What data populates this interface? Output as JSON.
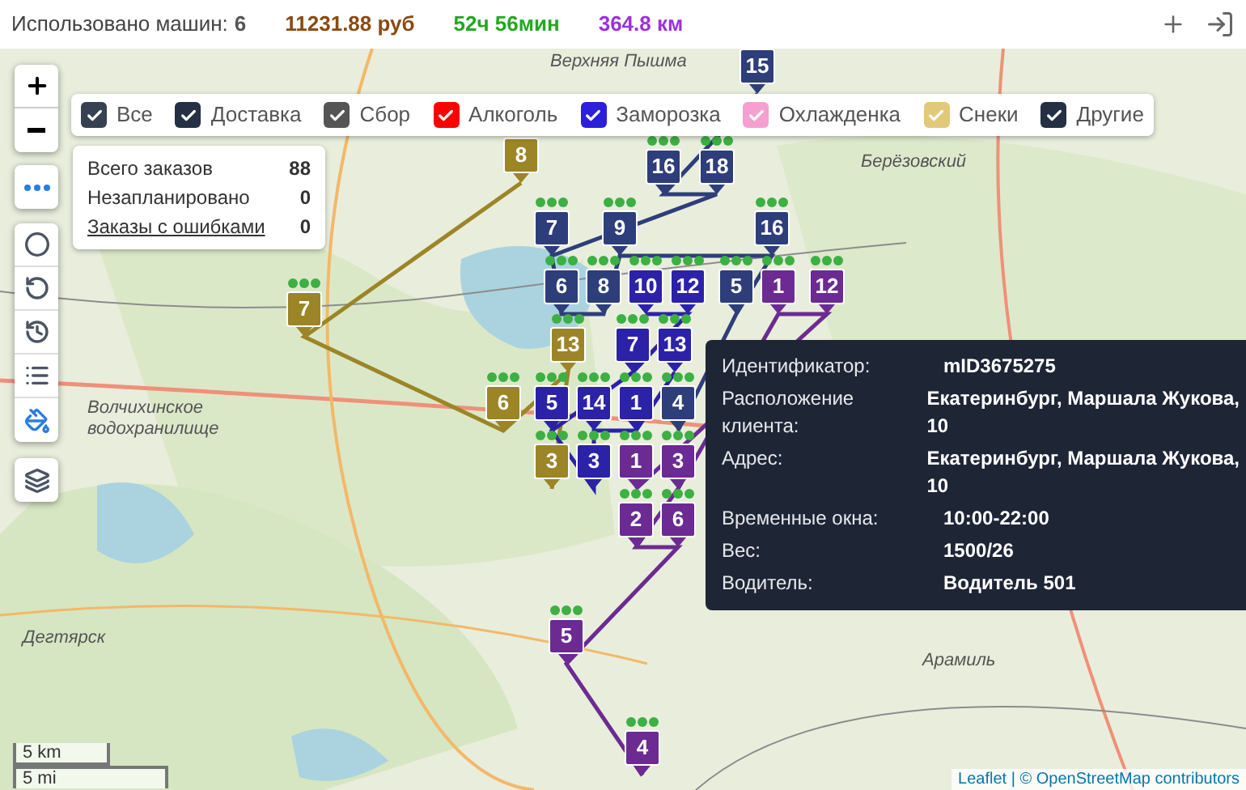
{
  "stats": {
    "label": "Использовано машин:",
    "vehicles": "6",
    "cost": "11231.88 руб",
    "time": "52ч 56мин",
    "distance": "364.8 км"
  },
  "filters": [
    {
      "label": "Все",
      "checked": true,
      "color": "#374151"
    },
    {
      "label": "Доставка",
      "checked": true,
      "color": "#263044"
    },
    {
      "label": "Сбор",
      "checked": true,
      "color": "#555555"
    },
    {
      "label": "Алкоголь",
      "checked": true,
      "color": "#ff0000"
    },
    {
      "label": "Заморозка",
      "checked": true,
      "color": "#2b1fdc"
    },
    {
      "label": "Охлажденка",
      "checked": true,
      "color": "#f5a0d0"
    },
    {
      "label": "Снеки",
      "checked": true,
      "color": "#e2c97a"
    },
    {
      "label": "Другие",
      "checked": true,
      "color": "#263044"
    }
  ],
  "summary": [
    {
      "label": "Всего заказов",
      "value": "88",
      "kind": "text"
    },
    {
      "label": "Незапланировано",
      "value": "0",
      "kind": "text"
    },
    {
      "label": "Заказы с ошибками",
      "value": "0",
      "kind": "link"
    }
  ],
  "map_labels": [
    "Верхняя Пышма",
    "Берёзовский",
    "Волчихинское водохранилище",
    "Дегтярск",
    "Арамиль"
  ],
  "routes": [
    {
      "color": "#9b8526",
      "stops": [
        "8",
        "7",
        "6",
        "13",
        "3"
      ]
    },
    {
      "color": "#2e3e7a",
      "stops": [
        "15",
        "16",
        "18",
        "7",
        "6",
        "8",
        "9",
        "16",
        "5",
        "4"
      ]
    },
    {
      "color": "#2c22a8",
      "stops": [
        "10",
        "12",
        "7",
        "5",
        "3",
        "14",
        "1",
        "13"
      ]
    },
    {
      "color": "#6b2b92",
      "stops": [
        "1",
        "12",
        "1",
        "3",
        "2",
        "6",
        "5",
        "4"
      ]
    }
  ],
  "tooltip": [
    {
      "label": "Идентификатор:",
      "value": [
        "mID3675275"
      ]
    },
    {
      "label": "Расположение клиента:",
      "value": [
        "Екатеринбург, Маршала Жукова,",
        "10"
      ]
    },
    {
      "label": "Адрес:",
      "value": [
        "Екатеринбург, Маршала Жукова,",
        "10"
      ]
    },
    {
      "label": "Временные окна:",
      "value": [
        "10:00-22:00"
      ]
    },
    {
      "label": "Вес:",
      "value": [
        "1500/26"
      ]
    },
    {
      "label": "Водитель:",
      "value": [
        "Водитель 501"
      ]
    }
  ],
  "scale": [
    "5 km",
    "5 mi"
  ],
  "attribution": "Leaflet | © OpenStreetMap contributors"
}
